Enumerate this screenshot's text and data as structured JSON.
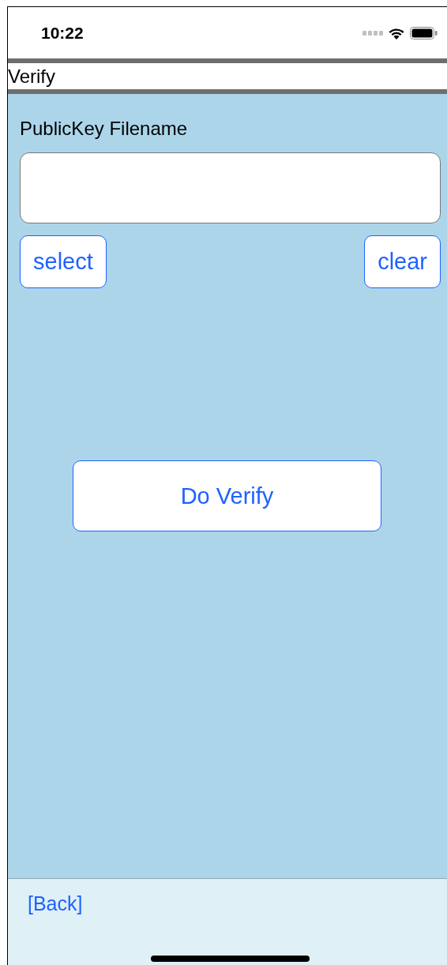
{
  "status_bar": {
    "time": "10:22"
  },
  "title": "Verify",
  "field": {
    "label": "PublicKey Filename"
  },
  "buttons": [
    "select",
    "clear"
  ],
  "action": "Do Verify",
  "footer": {
    "back": "[Back]"
  }
}
